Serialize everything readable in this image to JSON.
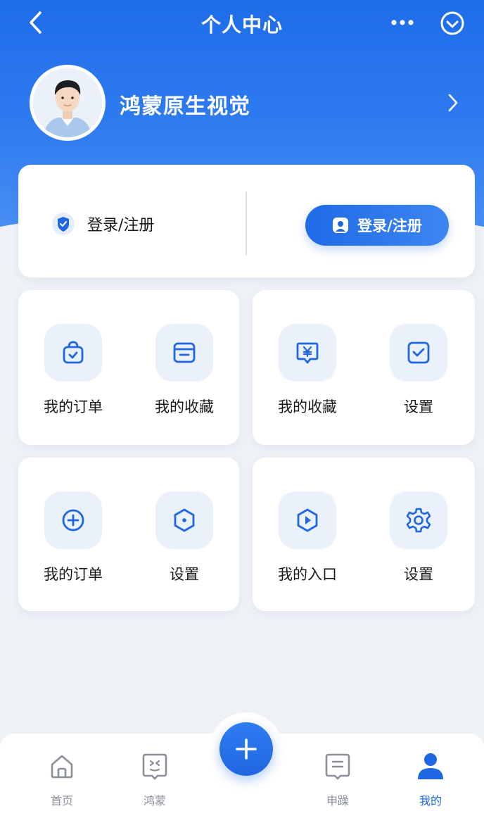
{
  "nav": {
    "title": "个人中心"
  },
  "profile": {
    "name": "鸿蒙原生视觉"
  },
  "login": {
    "left_label": "登录/注册",
    "button_label": "登录/注册"
  },
  "cards": [
    {
      "items": [
        {
          "label": "我的订单",
          "icon": "bag-check-icon"
        },
        {
          "label": "我的收藏",
          "icon": "folder-icon"
        }
      ]
    },
    {
      "items": [
        {
          "label": "我的收藏",
          "icon": "yuan-chat-icon"
        },
        {
          "label": "设置",
          "icon": "checkbox-icon"
        }
      ]
    },
    {
      "items": [
        {
          "label": "我的订单",
          "icon": "plus-circle-icon"
        },
        {
          "label": "设置",
          "icon": "hexagon-dot-icon"
        }
      ]
    },
    {
      "items": [
        {
          "label": "我的入口",
          "icon": "hexagon-play-icon"
        },
        {
          "label": "设置",
          "icon": "gear-icon"
        }
      ]
    }
  ],
  "tabbar": {
    "items": [
      {
        "label": "首页",
        "icon": "home-icon"
      },
      {
        "label": "鸿蒙",
        "icon": "smile-tag-icon"
      },
      {
        "label": "申躁",
        "icon": "document-icon"
      },
      {
        "label": "我的",
        "icon": "user-icon"
      }
    ],
    "active": "我的"
  },
  "colors": {
    "primary": "#1f67e2",
    "tile_bg": "#eaf1fb",
    "page_bg": "#eef1f6"
  }
}
